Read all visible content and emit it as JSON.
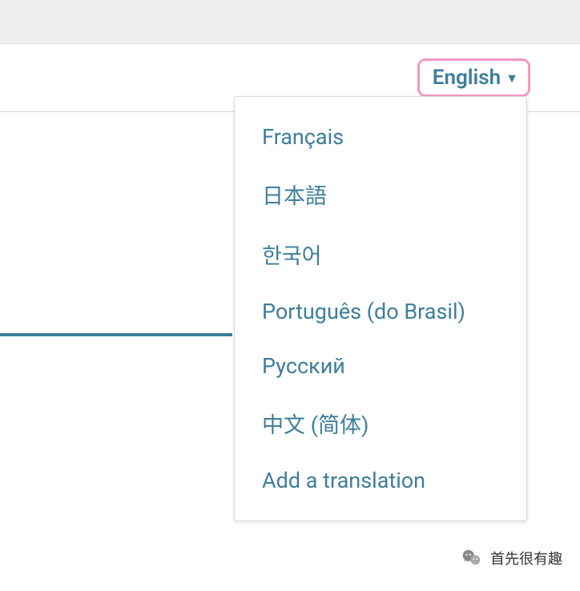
{
  "language_selector": {
    "current": "English",
    "dropdown_icon": "▼"
  },
  "dropdown": {
    "items": [
      "Français",
      "日本語",
      "한국어",
      "Português (do Brasil)",
      "Русский",
      "中文 (简体)",
      "Add a translation"
    ]
  },
  "attribution": {
    "text": "首先很有趣"
  }
}
